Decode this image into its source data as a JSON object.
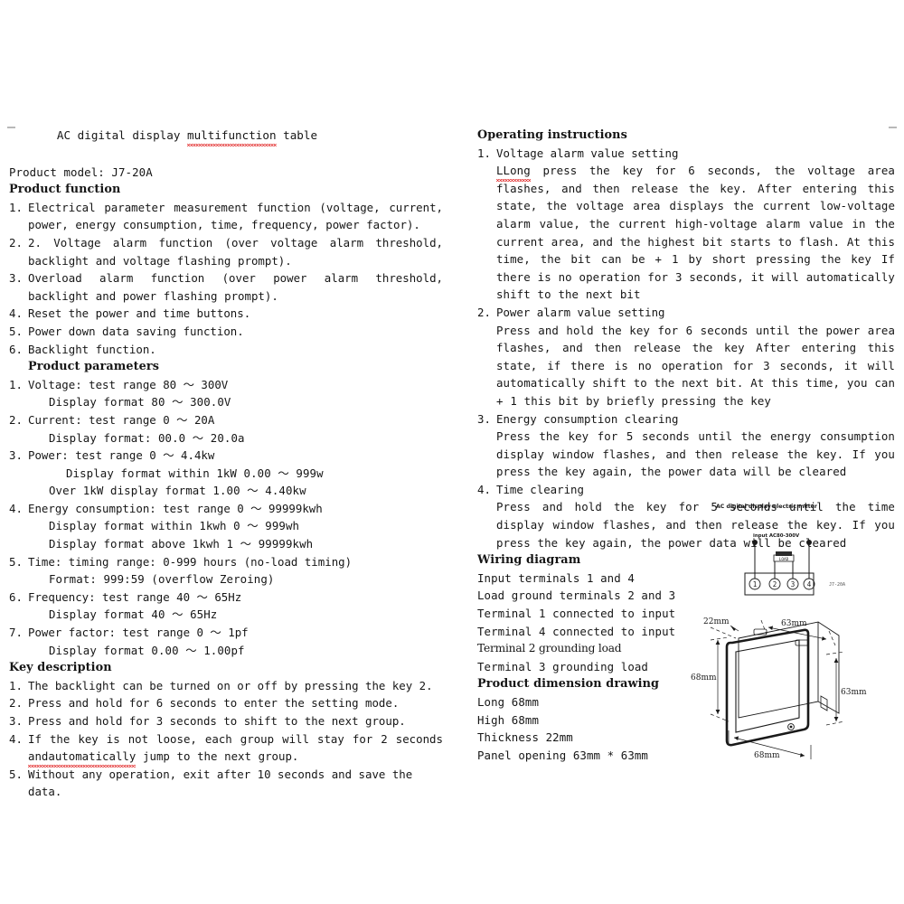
{
  "document": {
    "title": "AC digital display multifunction table",
    "title_misspelled_word": "multifunction"
  },
  "left_column": {
    "product_model": "Product model: J7-20A",
    "product_function_heading": "Product function",
    "product_function_items": [
      {
        "num": "1.",
        "text": "Electrical parameter measurement function (voltage, current, power, energy consumption, time, frequency, power factor)."
      },
      {
        "num": "2.",
        "text": "2. Voltage alarm function (over voltage alarm threshold, backlight and voltage flashing prompt)."
      },
      {
        "num": "3.",
        "text": "Overload alarm function (over power alarm threshold, backlight and power flashing prompt)."
      },
      {
        "num": "4.",
        "text": "Reset the power and time buttons."
      },
      {
        "num": "5.",
        "text": "Power down data saving function."
      },
      {
        "num": "6.",
        "text": "Backlight function."
      }
    ],
    "product_parameters_heading": "Product parameters",
    "product_parameters": [
      {
        "num": "1.",
        "title": "Voltage: test range 80 ～ 300V",
        "details": [
          "Display format 80 ～ 300.0V"
        ]
      },
      {
        "num": "2.",
        "title": "Current: test range 0 ～ 20A",
        "details": [
          "Display format: 00.0 ～ 20.0a"
        ]
      },
      {
        "num": "3.",
        "title": "Power: test range 0 ～ 4.4kw",
        "details": [
          "Display format within 1kW 0.00 ～ 999w",
          "Over 1kW display format 1.00 ～ 4.40kw"
        ]
      },
      {
        "num": "4.",
        "title": "Energy consumption: test range 0 ～ 99999kwh",
        "details": [
          "Display format within 1kwh 0 ～ 999wh",
          "Display format above 1kwh 1 ～ 99999kwh"
        ]
      },
      {
        "num": "5.",
        "title": "Time: timing range: 0-999 hours (no-load timing)",
        "details": [
          "Format: 999:59 (overflow Zeroing)"
        ]
      },
      {
        "num": "6.",
        "title": "Frequency: test range 40 ～ 65Hz",
        "details": [
          "Display format 40 ～ 65Hz"
        ]
      },
      {
        "num": "7.",
        "title": "Power factor: test range 0 ～ 1pf",
        "details": [
          "Display format 0.00 ～ 1.00pf"
        ]
      }
    ],
    "key_description_heading": "Key description",
    "key_description_items": [
      {
        "num": "1.",
        "text": "The backlight can be turned on or off by pressing the key 2."
      },
      {
        "num": "2.",
        "text": "Press and hold for 6 seconds to enter the setting mode."
      },
      {
        "num": "3.",
        "text": "Press and hold for 3 seconds to shift to the next group."
      },
      {
        "num": "4.",
        "text_before": "If the key is not loose, each group will stay for 2 seconds ",
        "misspelled": "andautomatically",
        "text_after": " jump to the next group."
      },
      {
        "num": "5.",
        "text": "Without any operation, exit after 10 seconds and save the data."
      }
    ]
  },
  "right_column": {
    "operating_instructions_heading": "Operating instructions",
    "operating_instructions": [
      {
        "num": "1.",
        "title": "Voltage alarm value setting",
        "misspelled": "LLong",
        "body": " press the key for 6 seconds, the voltage area flashes, and then release the key. After entering this state, the voltage area displays the current low-voltage alarm value, the current high-voltage alarm value in the current area, and the highest bit starts to flash. At this time, the bit can be + 1 by short pressing the key If there is no operation for 3 seconds, it will automatically shift to the next bit"
      },
      {
        "num": "2.",
        "title": "Power alarm value setting",
        "body": "Press and hold the key for 6 seconds until the power area flashes, and then release the key After entering this state, if there is no operation for 3 seconds, it will automatically shift to the next bit. At this time, you can + 1 this bit by briefly pressing the key"
      },
      {
        "num": "3.",
        "title": "Energy consumption clearing",
        "body": "Press the key for 5 seconds until the energy consumption display window flashes, and then release the key. If you press the key again, the power data will be cleared"
      },
      {
        "num": "4.",
        "title": "Time clearing",
        "body": "Press and hold the key for 5 seconds until the time display window flashes, and then release the key. If you press the key again, the power data will be cleared"
      }
    ],
    "wiring_diagram_heading": "Wiring diagram",
    "wiring_lines": [
      "Input terminals 1 and 4",
      "Load ground terminals 2 and 3",
      "Terminal 1 connected to input",
      "Terminal 4 connected to input",
      "Terminal 2 grounding load",
      "Terminal 3 grounding load"
    ],
    "dimension_heading": "Product dimension drawing",
    "dimension_lines": [
      "Long 68mm",
      "High 68mm",
      "Thickness 22mm",
      "Panel opening 63mm * 63mm"
    ]
  },
  "wiring_diagram": {
    "caption": "AC digital display electric meter",
    "input_label": "input AC80-300V",
    "load_label": "LOAD",
    "model_label": "J7-20A",
    "terminals": [
      "1",
      "2",
      "3",
      "4"
    ]
  },
  "dimension_drawing": {
    "depth": "22mm",
    "top_width": "63mm",
    "left_height": "68mm",
    "right_height": "63mm",
    "bottom_width": "68mm"
  },
  "colors": {
    "text": "#161616",
    "spellcheck": "#e01b1b",
    "diagram_line": "#1a1a1a"
  }
}
